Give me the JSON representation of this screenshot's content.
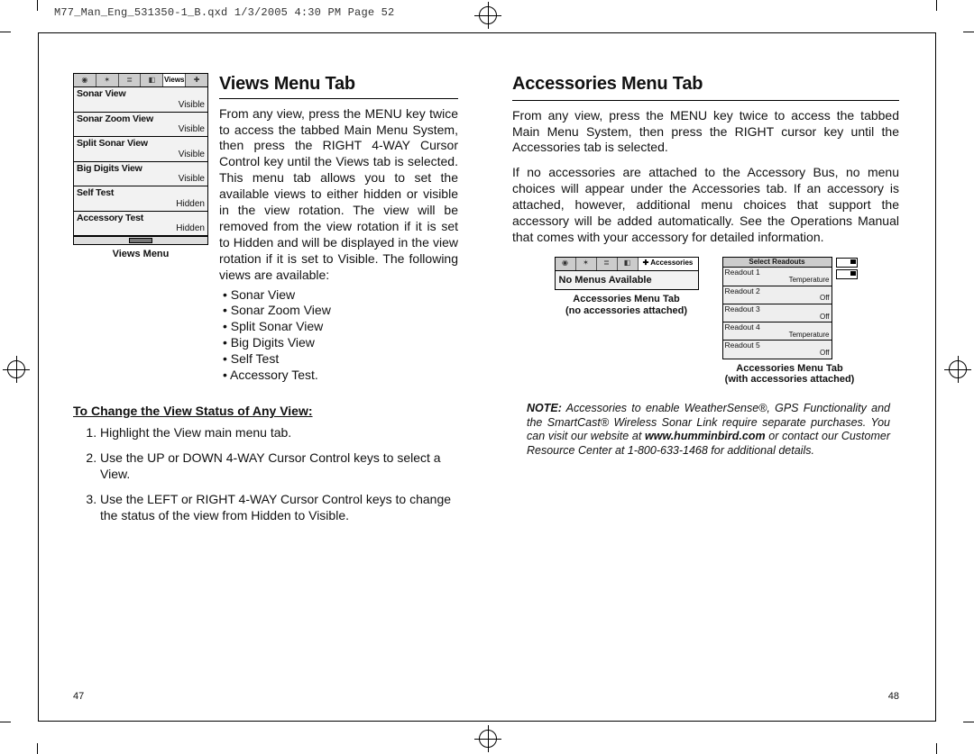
{
  "preheader": "M77_Man_Eng_531350-1_B.qxd  1/3/2005  4:30 PM  Page 52",
  "left": {
    "heading": "Views Menu Tab",
    "caption": "Views Menu",
    "intro": "From any view, press the MENU key twice to access the tabbed Main Menu System, then press the RIGHT 4-WAY Cursor Control key until the Views tab is selected. This menu tab allows you to set the available views to either hidden or visible in the view rotation. The view will be removed from the view rotation if it is set to Hidden and will be displayed in the view rotation if it is set to Visible. The following views are available:",
    "bullets": [
      "Sonar View",
      "Sonar Zoom View",
      "Split Sonar View",
      "Big Digits View",
      "Self Test",
      "Accessory Test."
    ],
    "tabs": [
      "◉",
      "✶",
      "≣",
      "◧",
      "Views",
      "✚"
    ],
    "menu_items": [
      {
        "name": "Sonar View",
        "val": "Visible"
      },
      {
        "name": "Sonar Zoom View",
        "val": "Visible"
      },
      {
        "name": "Split Sonar View",
        "val": "Visible"
      },
      {
        "name": "Big Digits View",
        "val": "Visible"
      },
      {
        "name": "Self Test",
        "val": "Hidden"
      },
      {
        "name": "Accessory Test",
        "val": "Hidden"
      }
    ],
    "subhead": "To Change the View Status of Any View:",
    "steps": [
      "Highlight the View main menu tab.",
      "Use the UP or DOWN 4-WAY Cursor Control keys to select a View.",
      "Use the LEFT or RIGHT 4-WAY Cursor Control keys to change the status of the view from Hidden to Visible."
    ],
    "pagenum": "47"
  },
  "right": {
    "heading": "Accessories Menu Tab",
    "p1": "From any view, press the MENU key twice to access the tabbed Main Menu System, then press the RIGHT cursor key until the Accessories tab is selected.",
    "p2": "If no accessories are attached to the Accessory Bus, no menu choices will appear under the Accessories tab. If an accessory is attached, however, additional menu choices that support the accessory will be added automatically. See the Operations Manual that comes with your accessory for detailed information.",
    "acc_tabs": [
      "◉",
      "✶",
      "≣",
      "◧",
      "✚ Accessories"
    ],
    "acc_body": "No Menus Available",
    "caption1": "Accessories Menu Tab\n(no accessories attached)",
    "readouts_header": "Select Readouts",
    "readouts": [
      {
        "name": "Readout 1",
        "val": "Temperature"
      },
      {
        "name": "Readout 2",
        "val": "Off"
      },
      {
        "name": "Readout 3",
        "val": "Off"
      },
      {
        "name": "Readout 4",
        "val": "Temperature"
      },
      {
        "name": "Readout 5",
        "val": "Off"
      }
    ],
    "caption2": "Accessories Menu Tab\n(with accessories attached)",
    "note_label": "NOTE:",
    "note_text_1": " Accessories to enable WeatherSense®, GPS Functionality and the SmartCast® Wireless Sonar Link require separate purchases. You can visit our website at ",
    "note_url": "www.humminbird.com",
    "note_text_2": " or contact our Customer Resource Center at 1-800-633-1468 for additional details.",
    "pagenum": "48"
  }
}
